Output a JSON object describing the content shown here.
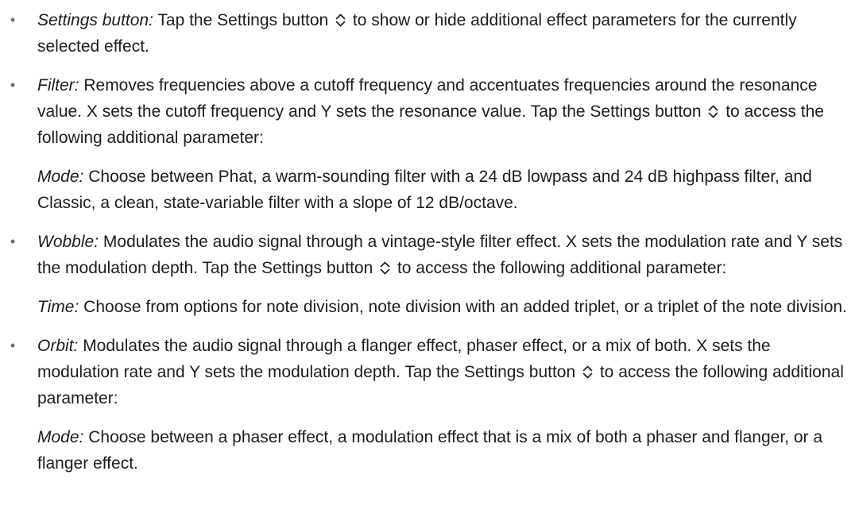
{
  "items": [
    {
      "paragraphs": [
        {
          "term": "Settings button:",
          "text_before": "Tap the Settings button",
          "icon": "up-down-chevron-icon",
          "text_after": "to show or hide additional effect parameters for the currently selected effect."
        }
      ]
    },
    {
      "paragraphs": [
        {
          "term": "Filter:",
          "text_before": "Removes frequencies above a cutoff frequency and accentuates frequencies around the resonance value. X sets the cutoff frequency and Y sets the resonance value. Tap the Settings button",
          "icon": "up-down-chevron-icon",
          "text_after": "to access the following additional parameter:"
        },
        {
          "term": "Mode:",
          "text_before": "Choose between Phat, a warm-sounding filter with a 24 dB lowpass and 24 dB highpass filter, and Classic, a clean, state-variable filter with a slope of 12 dB/octave."
        }
      ]
    },
    {
      "paragraphs": [
        {
          "term": "Wobble:",
          "text_before": "Modulates the audio signal through a vintage-style filter effect. X sets the modulation rate and Y sets the modulation depth. Tap the Settings button",
          "icon": "up-down-chevron-icon",
          "text_after": "to access the following additional parameter:"
        },
        {
          "term": "Time:",
          "text_before": "Choose from options for note division, note division with an added triplet, or a triplet of the note division."
        }
      ]
    },
    {
      "paragraphs": [
        {
          "term": "Orbit:",
          "text_before": "Modulates the audio signal through a flanger effect, phaser effect, or a mix of both. X sets the modulation rate and Y sets the modulation depth. Tap the Settings button",
          "icon": "up-down-chevron-icon",
          "text_after": "to access the following additional parameter:"
        },
        {
          "term": "Mode:",
          "text_before": "Choose between a phaser effect, a modulation effect that is a mix of both a phaser and flanger, or a flanger effect."
        }
      ]
    }
  ],
  "bullet_glyph": "•",
  "colors": {
    "text": "#1d1d1f",
    "bullet": "#6e6e73"
  }
}
